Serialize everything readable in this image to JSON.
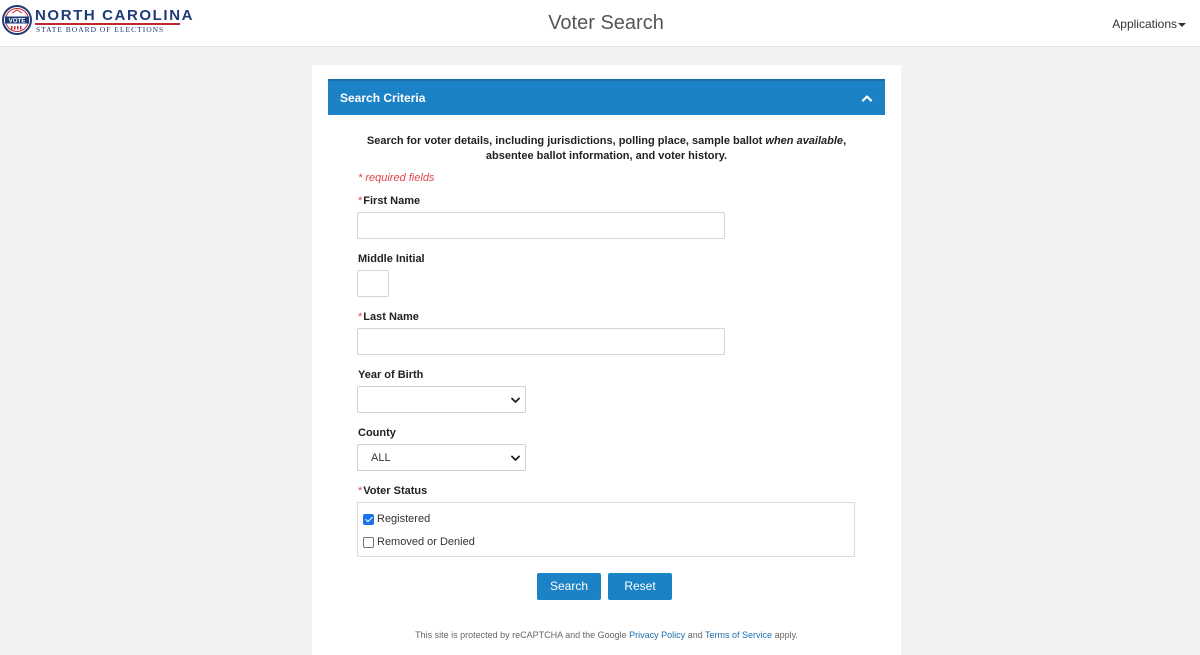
{
  "header": {
    "logo": {
      "seal_text": "VOTE",
      "title": "NORTH CAROLINA",
      "subtitle": "STATE BOARD OF ELECTIONS"
    },
    "page_title": "Voter Search",
    "applications_label": "Applications"
  },
  "panel": {
    "title": "Search Criteria",
    "intro_part1": "Search for voter details, including jurisdictions, polling place, sample ballot ",
    "intro_em": "when available",
    "intro_part2": ",",
    "intro_line2": "absentee ballot information, and voter history.",
    "required_note": "* required fields",
    "required_star": "*"
  },
  "form": {
    "first_name": {
      "label": "First Name",
      "value": ""
    },
    "middle_initial": {
      "label": "Middle Initial",
      "value": ""
    },
    "last_name": {
      "label": "Last Name",
      "value": ""
    },
    "year_of_birth": {
      "label": "Year of Birth",
      "selected": ""
    },
    "county": {
      "label": "County",
      "selected": "ALL"
    },
    "voter_status": {
      "label": "Voter Status",
      "options": [
        {
          "label": "Registered",
          "checked": true
        },
        {
          "label": "Removed or Denied",
          "checked": false
        }
      ]
    }
  },
  "buttons": {
    "search": "Search",
    "reset": "Reset"
  },
  "footer": {
    "text_before": "This site is protected by reCAPTCHA and the Google ",
    "privacy_link": "Privacy Policy",
    "text_middle": " and ",
    "terms_link": "Terms of Service",
    "text_after": " apply."
  },
  "colors": {
    "accent": "#1c82c6",
    "required": "#e0464b",
    "background": "#f2f2f2"
  }
}
